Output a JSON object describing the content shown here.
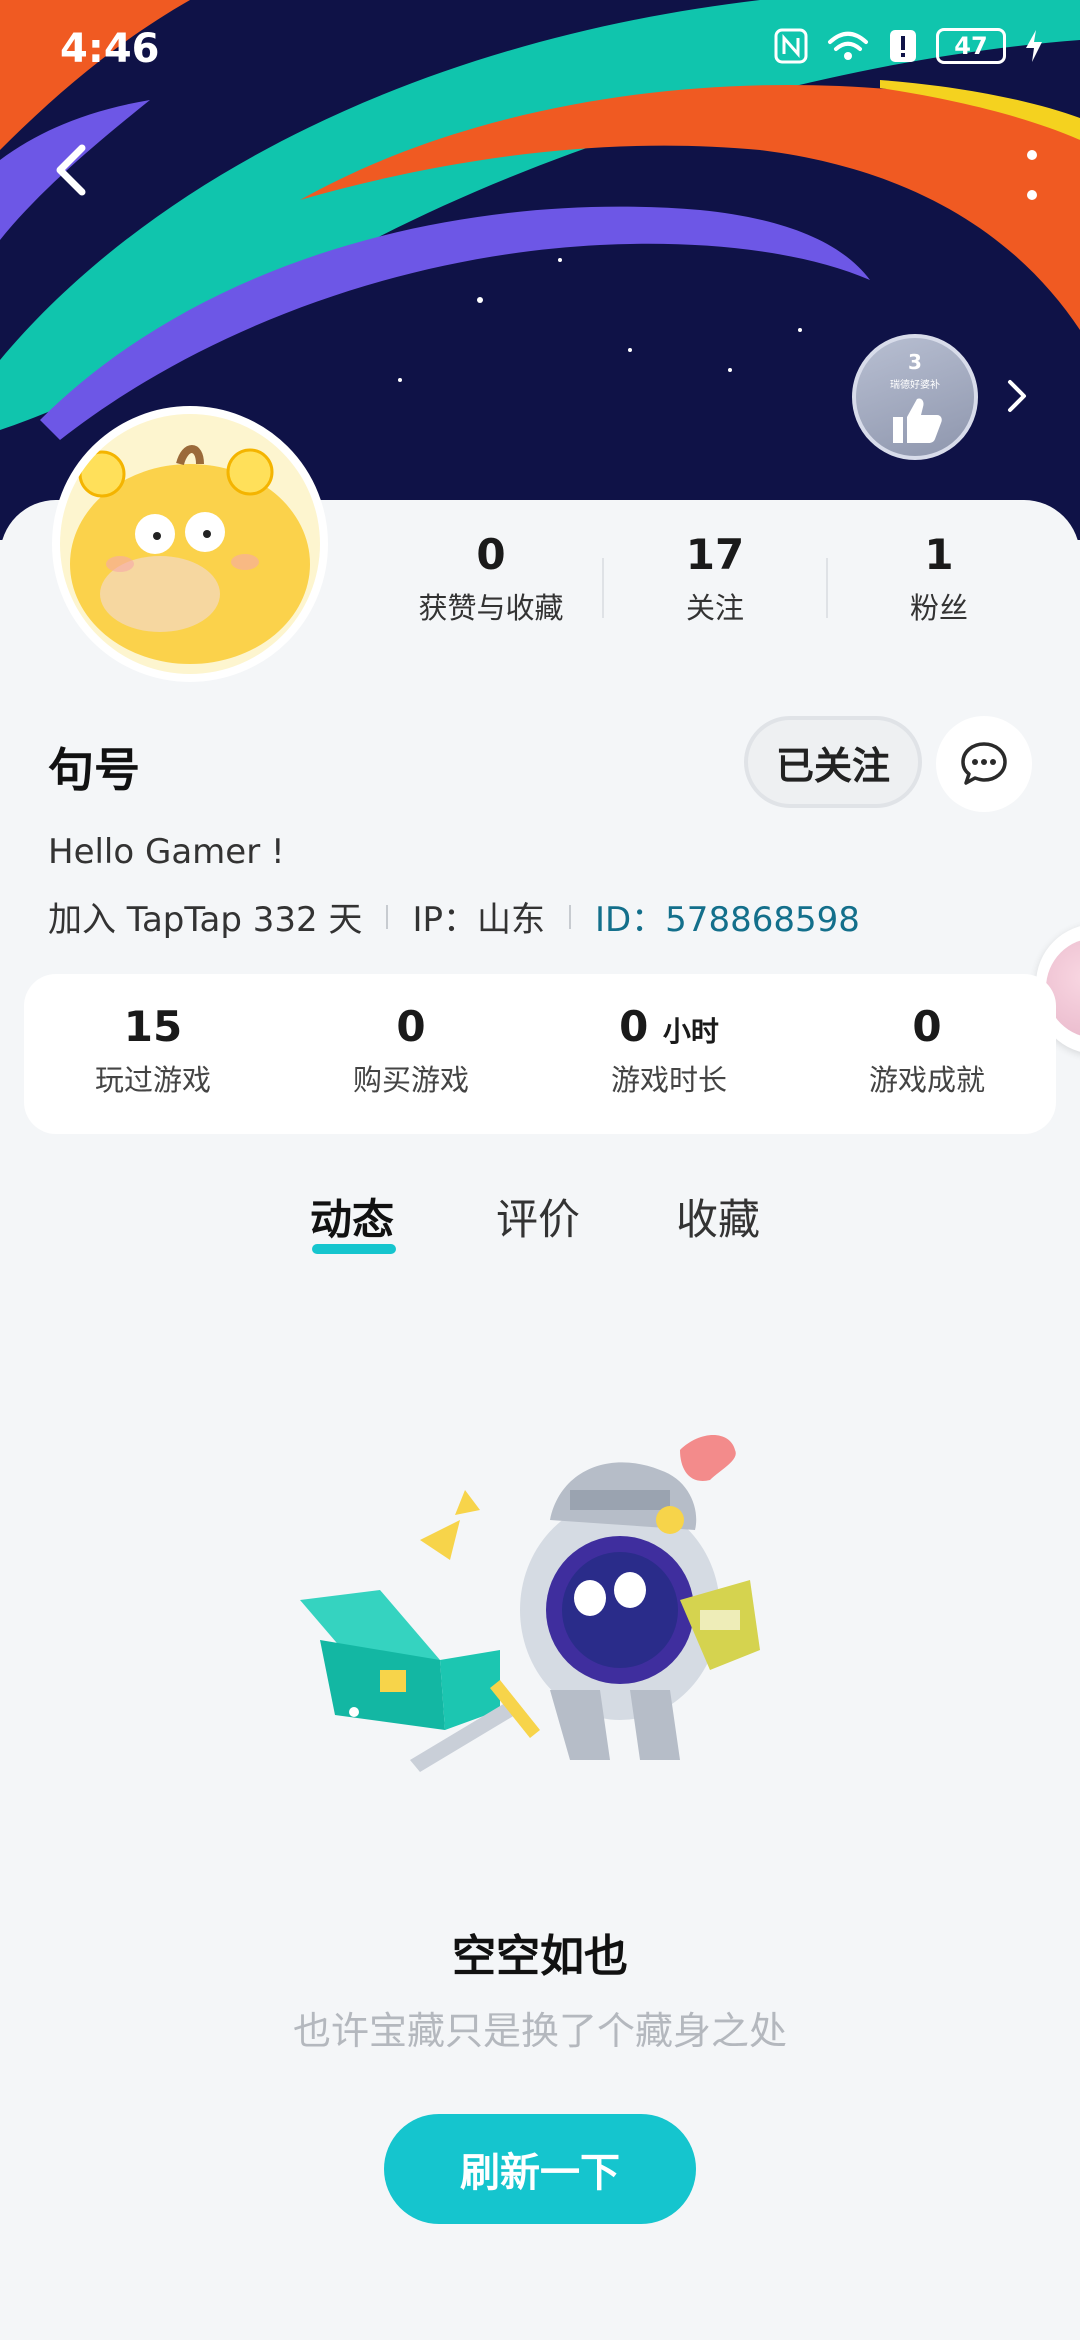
{
  "status_bar": {
    "time": "4:46",
    "battery": "47"
  },
  "profile": {
    "name": "句号",
    "bio": "Hello Gamer !",
    "join_text": "加入 TapTap 332 天",
    "ip_text": "IP：山东",
    "id_text": "ID：578868598",
    "follow_label": "已关注"
  },
  "badge": {
    "count": "3",
    "caption": "瑞德好婆补"
  },
  "stats": [
    {
      "value": "0",
      "label": "获赞与收藏"
    },
    {
      "value": "17",
      "label": "关注"
    },
    {
      "value": "1",
      "label": "粉丝"
    }
  ],
  "game_stats": [
    {
      "value": "15",
      "unit": "",
      "label": "玩过游戏"
    },
    {
      "value": "0",
      "unit": "",
      "label": "购买游戏"
    },
    {
      "value": "0",
      "unit": "小时",
      "label": "游戏时长"
    },
    {
      "value": "0",
      "unit": "",
      "label": "游戏成就"
    }
  ],
  "tabs": [
    {
      "label": "动态",
      "active": true
    },
    {
      "label": "评价",
      "active": false
    },
    {
      "label": "收藏",
      "active": false
    }
  ],
  "empty_state": {
    "title": "空空如也",
    "subtitle": "也许宝藏只是换了个藏身之处",
    "button": "刷新一下"
  },
  "colors": {
    "accent": "#15c5ce",
    "id_link": "#136f8b",
    "banner_bg": "#0f1247"
  }
}
